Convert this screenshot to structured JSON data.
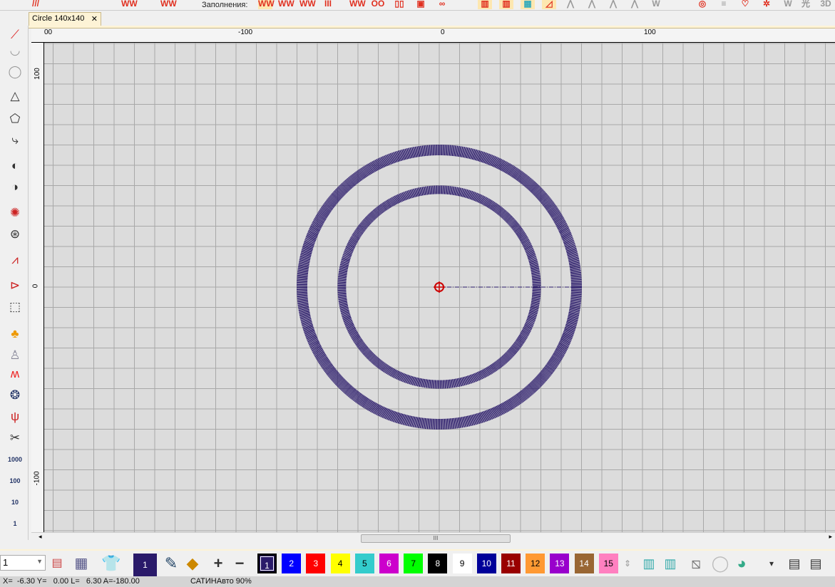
{
  "toolbar": {
    "fills_label": "Заполнения:"
  },
  "document_tab": {
    "title": "Circle 140x140",
    "close": "✕"
  },
  "ruler": {
    "h_labels": [
      "00",
      "-100",
      "0",
      "100"
    ],
    "v_labels": [
      "100",
      "0",
      "-100"
    ]
  },
  "design": {
    "center": [
      0,
      0
    ],
    "outer_circle_radius_units": 70,
    "inner_circle_radius_units": 49,
    "stitch_color": "#2a1a6a",
    "center_marker_color": "#cc0000"
  },
  "left_toolbar": {
    "step_labels": [
      "1000",
      "100",
      "10",
      "1"
    ]
  },
  "bottom": {
    "stitch_length_value": "1",
    "current_color_label": "1",
    "palette": [
      {
        "label": "1",
        "color": "#2a1a6a",
        "selected": true
      },
      {
        "label": "2",
        "color": "#0000ff"
      },
      {
        "label": "3",
        "color": "#ff0000"
      },
      {
        "label": "4",
        "color": "#ffff00"
      },
      {
        "label": "5",
        "color": "#33cccc"
      },
      {
        "label": "6",
        "color": "#cc00cc"
      },
      {
        "label": "7",
        "color": "#00ff00"
      },
      {
        "label": "8",
        "color": "#000000"
      },
      {
        "label": "9",
        "color": "#ffffff"
      },
      {
        "label": "10",
        "color": "#000099"
      },
      {
        "label": "11",
        "color": "#990000"
      },
      {
        "label": "12",
        "color": "#ff9933"
      },
      {
        "label": "13",
        "color": "#9900cc"
      },
      {
        "label": "14",
        "color": "#996633"
      },
      {
        "label": "15",
        "color": "#ff80c0"
      }
    ]
  },
  "status": {
    "coords": "X=  -6.30 Y=   0.00 L=   6.30 A=-180.00",
    "mode": "САТИНАвто 90%"
  }
}
